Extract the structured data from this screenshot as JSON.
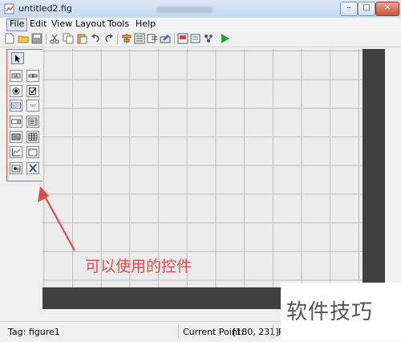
{
  "window": {
    "title": "untitled2.fig",
    "buttons": {
      "minimize": "–",
      "maximize": "□",
      "close": "✕"
    }
  },
  "menu": {
    "items": [
      "File",
      "Edit",
      "View",
      "Layout",
      "Tools",
      "Help"
    ],
    "active": "File"
  },
  "toolbar": {
    "icons": [
      "new-file-icon",
      "open-folder-icon",
      "save-icon",
      "cut-icon",
      "copy-icon",
      "paste-icon",
      "undo-icon",
      "redo-icon",
      "align-icon",
      "menu-editor-icon",
      "tab-order-icon",
      "toolbar-editor-icon",
      "m-file-editor-icon",
      "property-inspector-icon",
      "object-browser-icon",
      "run-icon"
    ]
  },
  "palette": {
    "controls": [
      "select-arrow",
      "push-button",
      "slider",
      "radio-button",
      "checkbox",
      "edit-text",
      "static-text",
      "popup-menu",
      "listbox",
      "toggle-button",
      "table",
      "axes",
      "panel",
      "button-group",
      "activex-control"
    ],
    "labels": {
      "edit-text": "EDT",
      "static-text": "TXT"
    }
  },
  "annotation": {
    "text": "可以使用的控件"
  },
  "status": {
    "tag": "Tag: figure1",
    "current_point_label": "Current Point:",
    "current_point_value": "[180, 231]",
    "trailing": "P"
  },
  "watermark": {
    "text": "软件技巧"
  },
  "colors": {
    "annotation": "#e24b4b",
    "dark_panel": "#3f3f3f",
    "run_green": "#2aa52a"
  }
}
